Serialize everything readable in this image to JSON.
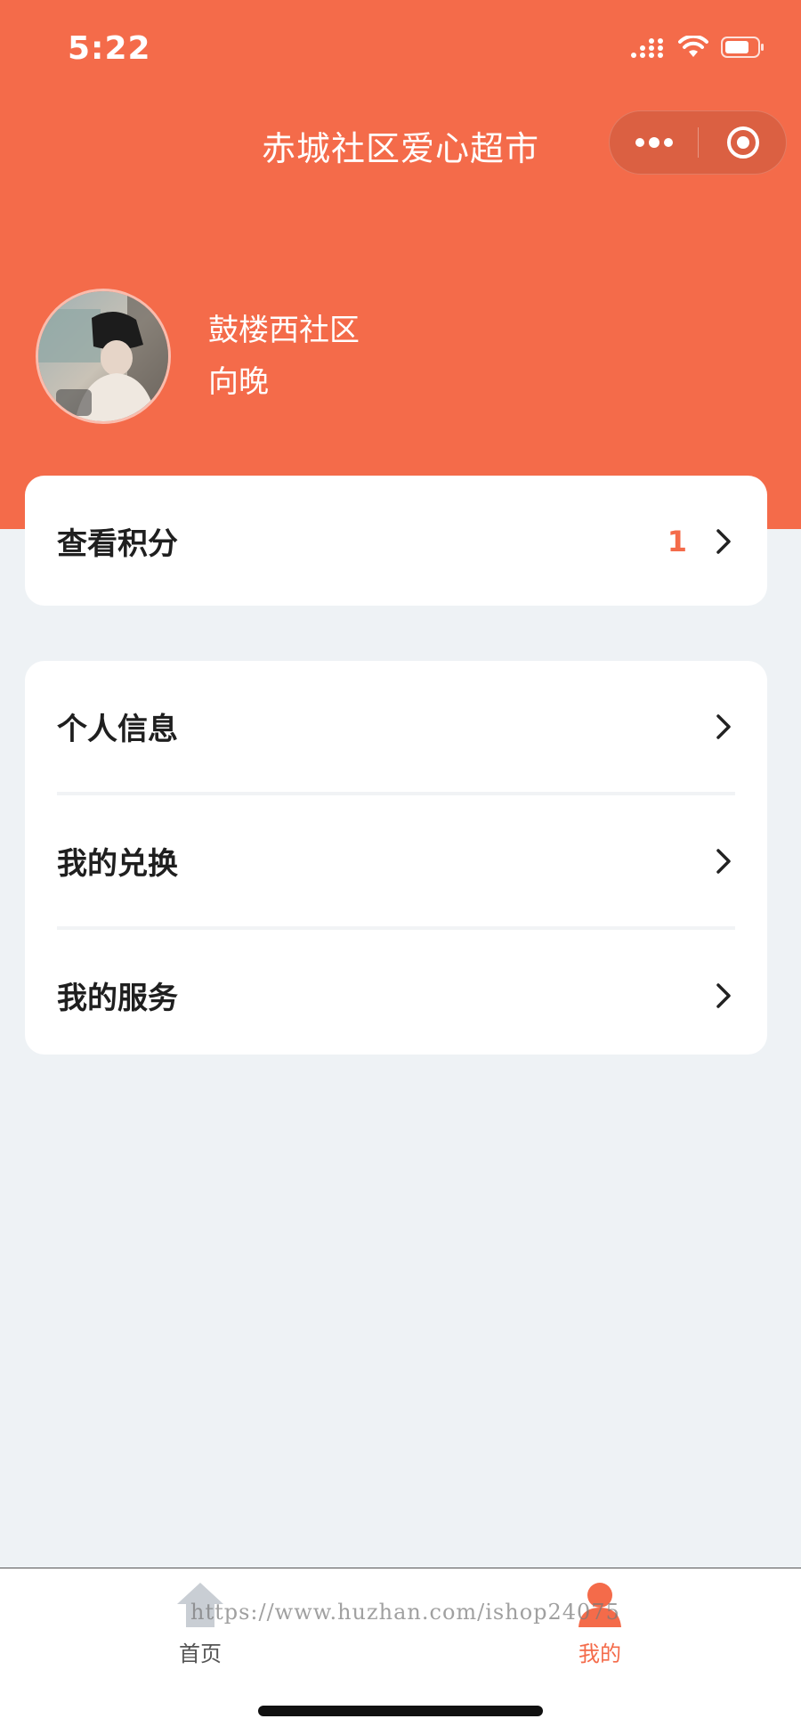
{
  "status_bar": {
    "time": "5:22",
    "signal_icon": "signal-icon",
    "wifi_icon": "wifi-icon",
    "battery_icon": "battery-icon"
  },
  "nav": {
    "title": "赤城社区爱心超市",
    "more_icon": "more-dots-icon",
    "close_icon": "target-close-icon"
  },
  "profile": {
    "community": "鼓楼西社区",
    "name": "向晚"
  },
  "points_card": {
    "label": "查看积分",
    "value": "1"
  },
  "menu": {
    "items": [
      {
        "label": "个人信息"
      },
      {
        "label": "我的兑换"
      },
      {
        "label": "我的服务"
      }
    ]
  },
  "tabbar": {
    "tabs": [
      {
        "label": "首页",
        "icon": "home-icon",
        "active": false
      },
      {
        "label": "我的",
        "icon": "user-icon",
        "active": true
      }
    ]
  },
  "watermark": "https://www.huzhan.com/ishop24075",
  "colors": {
    "accent": "#f46b4a",
    "page_bg": "#eef2f5",
    "card_bg": "#ffffff"
  }
}
